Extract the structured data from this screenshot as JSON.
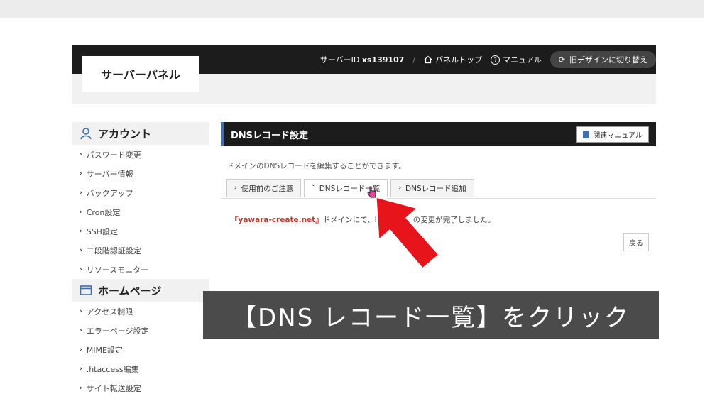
{
  "header": {
    "logo": "サーバーパネル",
    "server_id_label": "サーバーID",
    "server_id_value": "xs139107",
    "separator": "/",
    "panel_top": "パネルトップ",
    "manual": "マニュアル",
    "old_design": "旧デザインに切り替え"
  },
  "sidebar": {
    "sections": [
      {
        "title": "アカウント",
        "icon": "user-icon",
        "items": [
          "パスワード変更",
          "サーバー情報",
          "バックアップ",
          "Cron設定",
          "SSH設定",
          "二段階認証設定",
          "リソースモニター"
        ]
      },
      {
        "title": "ホームページ",
        "icon": "window-icon",
        "items": [
          "アクセス制限",
          "エラーページ設定",
          "MIME設定",
          ".htaccess編集",
          "サイト転送設定"
        ]
      }
    ]
  },
  "main": {
    "title": "DNSレコード設定",
    "manual_button": "関連マニュアル",
    "description": "ドメインのDNSレコードを編集することができます。",
    "tabs": [
      {
        "label": "使用前のご注意",
        "chevron": "›"
      },
      {
        "label": "DNSレコード一覧",
        "chevron": "˅"
      },
      {
        "label": "DNSレコード追加",
        "chevron": "›"
      }
    ],
    "result_domain": "『yawara-create.net』",
    "result_text_1": "ドメインにて、D",
    "result_text_2": "の変更が完了しました。",
    "back_button": "戻る"
  },
  "overlay": {
    "caption": "【DNS レコード一覧】をクリック"
  },
  "colors": {
    "header_bg": "#1c1c1c",
    "accent": "#3d6fb6",
    "arrow": "#e8141b",
    "domain_text": "#c0392b"
  }
}
